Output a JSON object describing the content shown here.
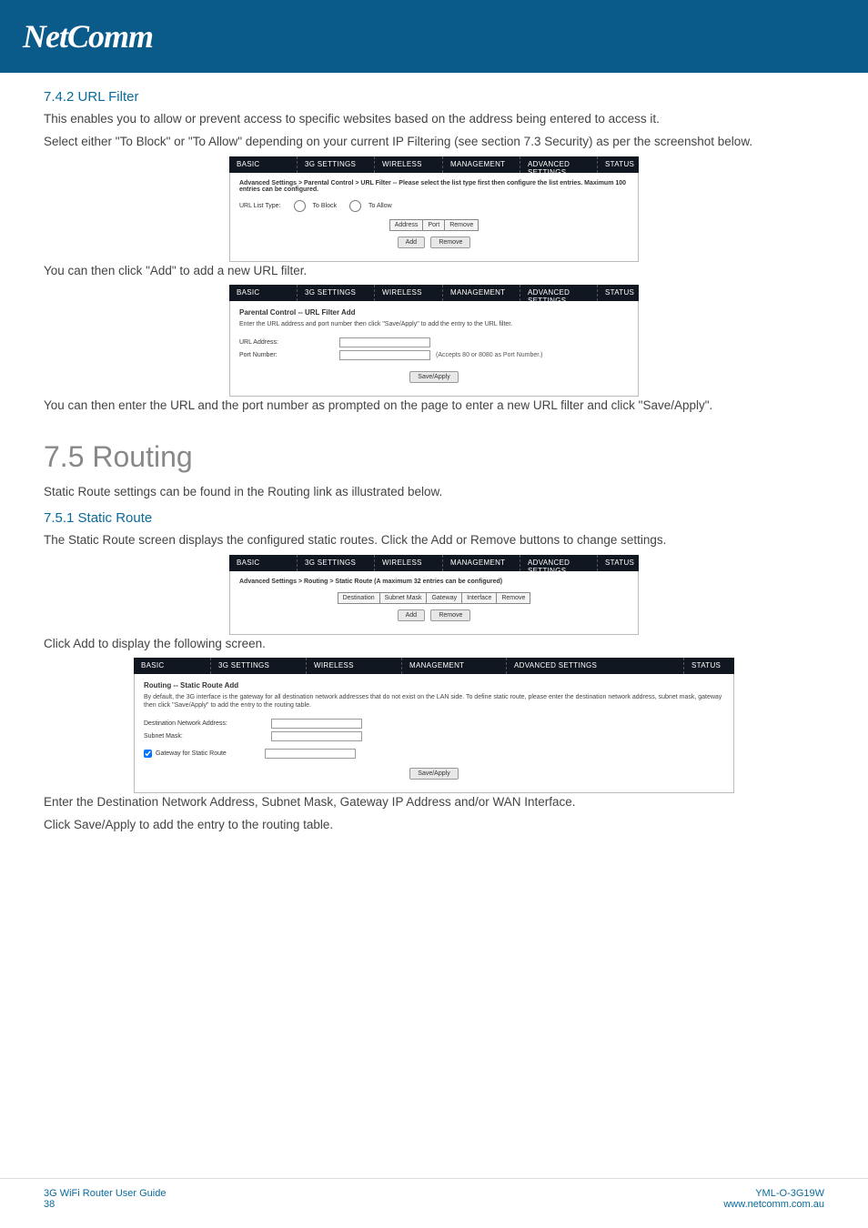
{
  "header": {
    "logo": "NetComm"
  },
  "section_742": {
    "title": "7.4.2 URL Filter",
    "p1": "This enables you to allow or prevent access to specific websites based on the address being entered to access it.",
    "p2": "Select either \"To Block\" or \"To Allow\" depending on your current IP Filtering (see section  7.3 Security) as per the screenshot below.",
    "p3": "You can then click \"Add\" to add a new URL filter.",
    "p4": "You can then enter the URL and the port number as prompted on the page to enter a new URL filter and click \"Save/Apply\"."
  },
  "router_tabs": {
    "basic": "BASIC",
    "tgsettings": "3G SETTINGS",
    "wireless": "WIRELESS",
    "management": "MANAGEMENT",
    "advanced": "ADVANCED SETTINGS",
    "status": "STATUS"
  },
  "ui1": {
    "breadcrumb": "Advanced Settings > Parental Control > URL Filter -- Please select the list type first then configure the list entries. Maximum 100 entries can be configured.",
    "urllist_label": "URL List Type:",
    "opt_block": "To Block",
    "opt_allow": "To Allow",
    "th_address": "Address",
    "th_port": "Port",
    "th_remove": "Remove",
    "btn_add": "Add",
    "btn_remove": "Remove"
  },
  "ui2": {
    "title": "Parental Control -- URL Filter Add",
    "desc": "Enter the URL address and port number then click \"Save/Apply\" to add the entry to the URL filter.",
    "url_label": "URL Address:",
    "port_label": "Port Number:",
    "port_note": "(Accepts 80 or 8080 as Port Number.)",
    "btn_save": "Save/Apply"
  },
  "section_75": {
    "title": "7.5 Routing",
    "p1": "Static Route settings can be found in the Routing link as illustrated below."
  },
  "section_751": {
    "title": "7.5.1 Static Route",
    "p1": "The Static Route screen displays the configured static routes. Click the Add or Remove buttons to change settings.",
    "p2": "Click Add to display the following screen.",
    "p3": "Enter the Destination Network Address, Subnet Mask, Gateway IP Address and/or WAN Interface.",
    "p4": "Click Save/Apply to add the entry to the routing table."
  },
  "ui3": {
    "breadcrumb": "Advanced Settings > Routing > Static Route (A maximum 32 entries can be configured)",
    "th_dest": "Destination",
    "th_subnet": "Subnet Mask",
    "th_gateway": "Gateway",
    "th_interface": "Interface",
    "th_remove": "Remove",
    "btn_add": "Add",
    "btn_remove": "Remove"
  },
  "ui4": {
    "title": "Routing -- Static Route Add",
    "desc": "By default, the 3G interface is the gateway for all destination network addresses that do not exist on the LAN side. To define static route, please enter the destination network address, subnet mask, gateway then click \"Save/Apply\" to add the entry to the routing table.",
    "dest_label": "Destination Network Address:",
    "subnet_label": "Subnet Mask:",
    "gateway_label": "Gateway for Static Route",
    "btn_save": "Save/Apply"
  },
  "footer": {
    "left1": "3G WiFi Router User Guide",
    "left2": "38",
    "right1": "YML-O-3G19W",
    "right2": "www.netcomm.com.au"
  }
}
